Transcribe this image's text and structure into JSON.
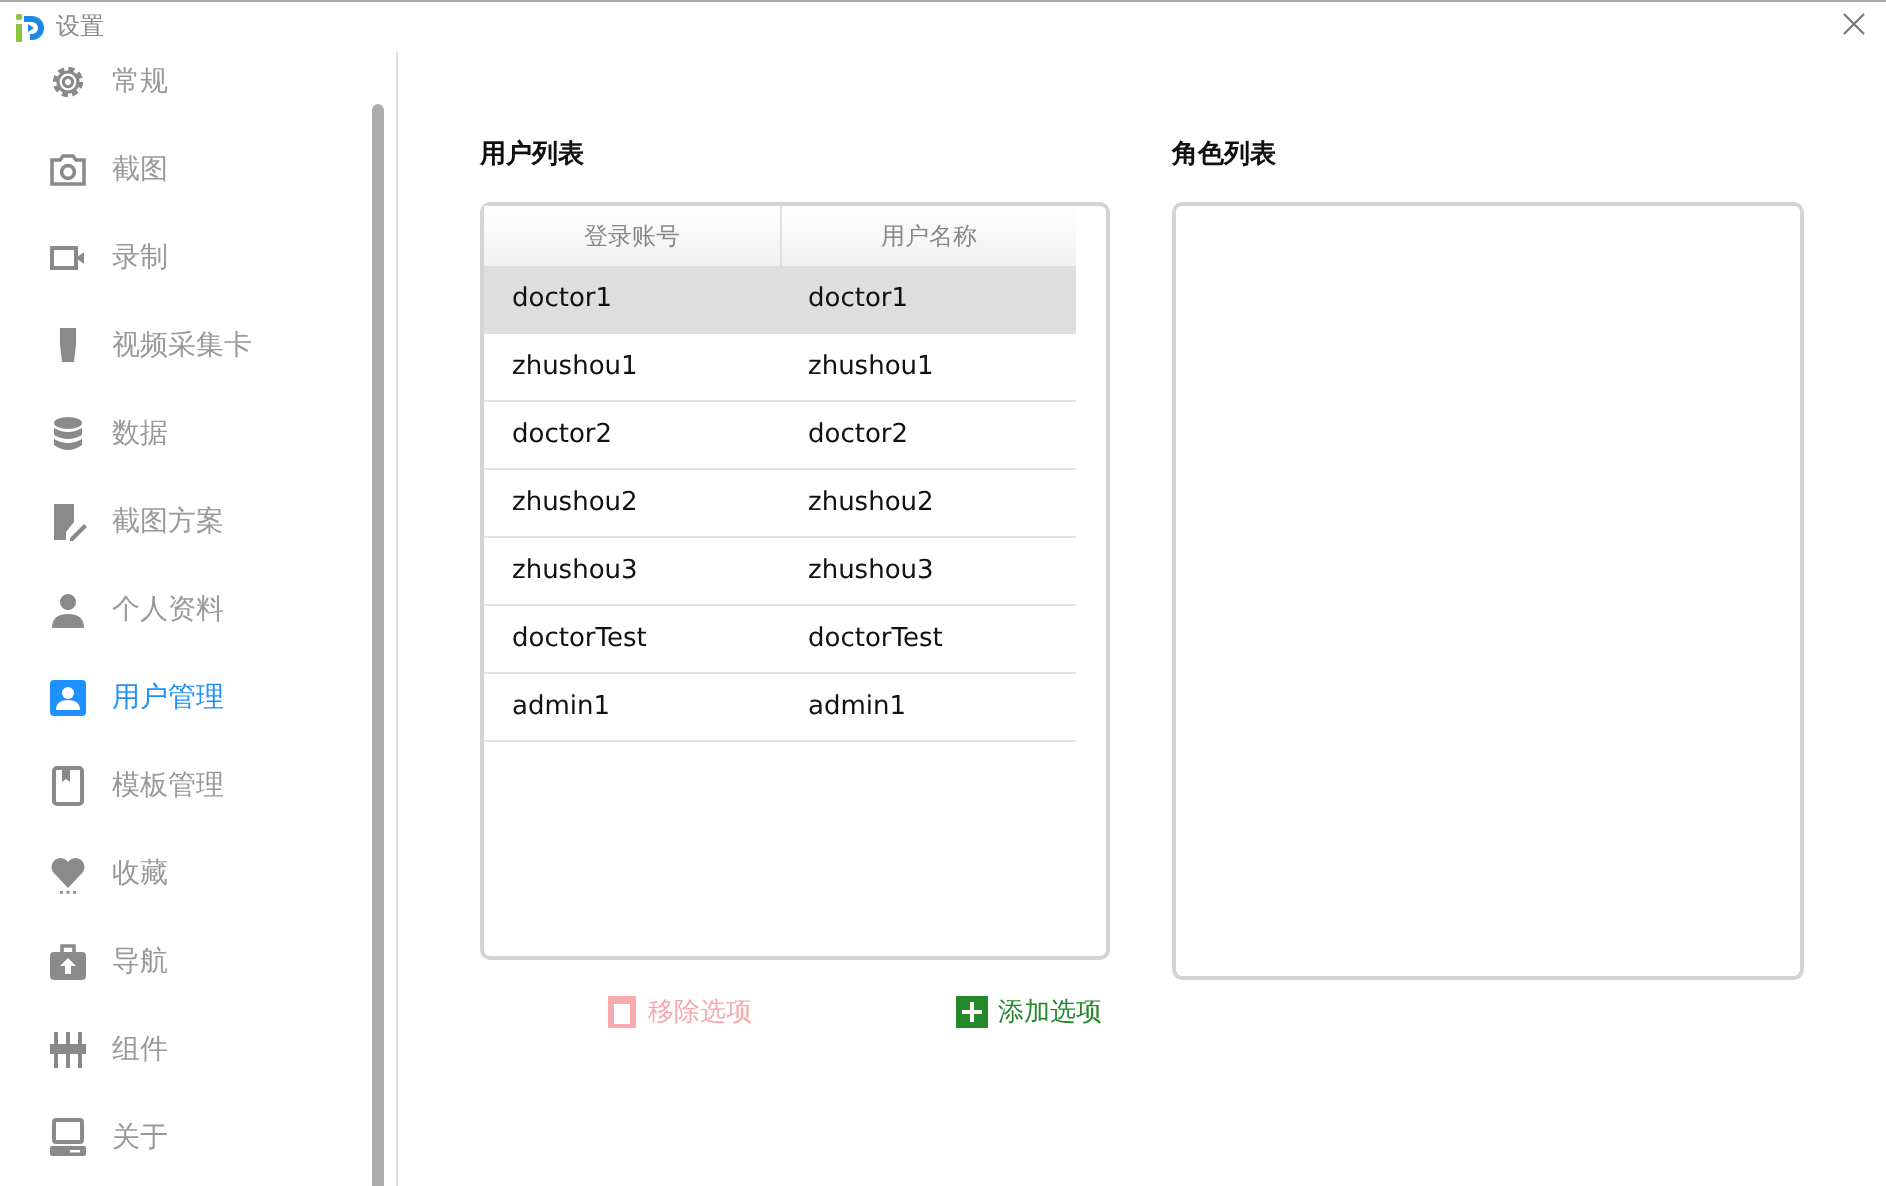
{
  "window": {
    "title": "设置"
  },
  "sidebar": {
    "items": [
      {
        "label": "常规",
        "selected": false
      },
      {
        "label": "截图",
        "selected": false
      },
      {
        "label": "录制",
        "selected": false
      },
      {
        "label": "视频采集卡",
        "selected": false
      },
      {
        "label": "数据",
        "selected": false
      },
      {
        "label": "截图方案",
        "selected": false
      },
      {
        "label": "个人资料",
        "selected": false
      },
      {
        "label": "用户管理",
        "selected": true
      },
      {
        "label": "模板管理",
        "selected": false
      },
      {
        "label": "收藏",
        "selected": false
      },
      {
        "label": "导航",
        "selected": false
      },
      {
        "label": "组件",
        "selected": false
      },
      {
        "label": "关于",
        "selected": false
      }
    ]
  },
  "user_list": {
    "title": "用户列表",
    "columns": [
      "登录账号",
      "用户名称"
    ],
    "rows": [
      {
        "cells": [
          "doctor1",
          "doctor1"
        ],
        "selected": true
      },
      {
        "cells": [
          "zhushou1",
          "zhushou1"
        ],
        "selected": false
      },
      {
        "cells": [
          "doctor2",
          "doctor2"
        ],
        "selected": false
      },
      {
        "cells": [
          "zhushou2",
          "zhushou2"
        ],
        "selected": false
      },
      {
        "cells": [
          "zhushou3",
          "zhushou3"
        ],
        "selected": false
      },
      {
        "cells": [
          "doctorTest",
          "doctorTest"
        ],
        "selected": false
      },
      {
        "cells": [
          "admin1",
          "admin1"
        ],
        "selected": false
      }
    ]
  },
  "role_list": {
    "title": "角色列表"
  },
  "buttons": [
    {
      "label": "移除选项",
      "kind": "remove",
      "disabled": true
    },
    {
      "label": "添加选项",
      "kind": "add",
      "disabled": false
    }
  ]
}
